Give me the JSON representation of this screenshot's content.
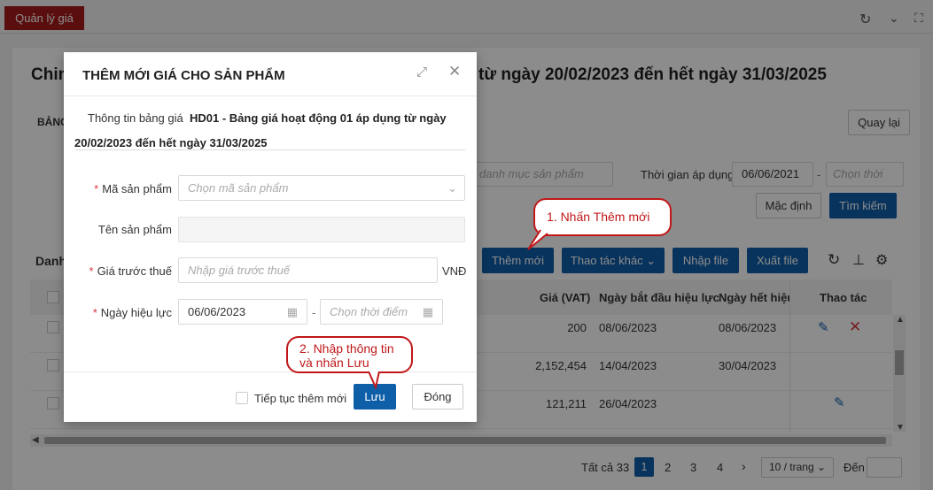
{
  "app_tab": "Quản lý giá",
  "page": {
    "title_left": "Chin",
    "title_right": "từ ngày 20/02/2023 đến hết ngày 31/03/2025",
    "section_left": "BẢNG",
    "back_button": "Quay lại",
    "category_placeholder": "danh mục sản phẩm",
    "apply_time_label": "Thời gian áp dụng",
    "apply_from": "06/06/2021",
    "apply_to_placeholder": "Chọn thời",
    "default_button": "Mặc định",
    "search_button": "Tìm kiếm",
    "list_title": "Danh",
    "add_button": "Thêm mới",
    "other_actions": "Thao tác khác",
    "import_button": "Nhập file",
    "export_button": "Xuất file"
  },
  "table": {
    "headers": [
      "Giá (VAT)",
      "Ngày bắt đầu hiệu lực",
      "Ngày hết hiệu",
      "Thao tác"
    ],
    "rows": [
      {
        "price": "200",
        "start": "08/06/2023",
        "end": "08/06/2023"
      },
      {
        "price": "2,152,454",
        "start": "14/04/2023",
        "end": "30/04/2023"
      },
      {
        "price": "121,211",
        "start": "26/04/2023",
        "end": ""
      }
    ]
  },
  "pagination": {
    "total": "Tất cả 33",
    "pages": [
      "1",
      "2",
      "3",
      "4"
    ],
    "per_page": "10 / trang",
    "goto_label": "Đến"
  },
  "modal": {
    "title": "THÊM MỚI GIÁ CHO SẢN PHẨM",
    "info_label": "Thông tin bảng giá",
    "info_value_line1": "HD01 - Bảng giá hoạt động 01 áp dụng từ ngày",
    "info_value_line2": "20/02/2023 đến hết ngày 31/03/2025",
    "product_code_label": "Mã sản phẩm",
    "product_code_placeholder": "Chọn mã sản phẩm",
    "product_name_label": "Tên sản phẩm",
    "price_label": "Giá trước thuế",
    "price_placeholder": "Nhập giá trước thuế",
    "currency": "VNĐ",
    "effective_label": "Ngày hiệu lực",
    "effective_from": "06/06/2023",
    "effective_to_placeholder": "Chọn thời điểm",
    "continue_label": "Tiếp tục thêm mới",
    "save_button": "Lưu",
    "close_button": "Đóng"
  },
  "callouts": {
    "step1": "1. Nhấn Thêm mới",
    "step2_line1": "2. Nhập thông tin",
    "step2_line2": "và nhấn Lưu"
  },
  "colors": {
    "primary": "#0f5ea8",
    "brand_red": "#a51b1b",
    "callout_red": "#c0181a"
  }
}
